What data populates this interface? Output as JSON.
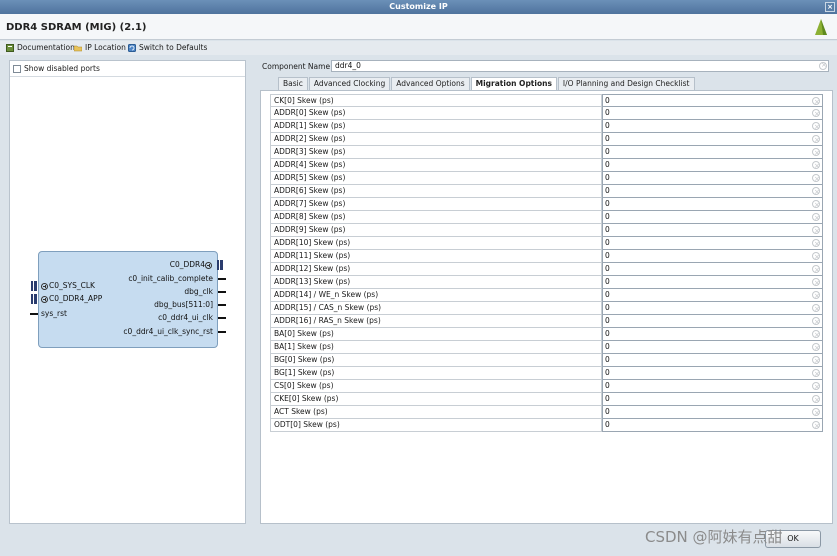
{
  "window": {
    "title": "Customize IP",
    "close_glyph": "×"
  },
  "header": {
    "app_title": "DDR4 SDRAM (MIG) (2.1)",
    "logo_icon": "vivado-logo-icon"
  },
  "toolbar": {
    "documentation": "Documentation",
    "ip_location": "IP Location",
    "switch_defaults": "Switch to Defaults"
  },
  "left_panel": {
    "show_disabled_ports": "Show disabled ports",
    "block": {
      "left_ports": [
        "C0_SYS_CLK",
        "C0_DDR4_APP",
        "sys_rst"
      ],
      "right_ports": [
        "C0_DDR4",
        "c0_init_calib_complete",
        "dbg_clk",
        "dbg_bus[511:0]",
        "c0_ddr4_ui_clk",
        "c0_ddr4_ui_clk_sync_rst"
      ]
    }
  },
  "component": {
    "label": "Component Name",
    "value": "ddr4_0"
  },
  "tabs": [
    {
      "label": "Basic"
    },
    {
      "label": "Advanced Clocking"
    },
    {
      "label": "Advanced Options"
    },
    {
      "label": "Migration Options"
    },
    {
      "label": "I/O Planning and Design Checklist"
    }
  ],
  "active_tab": "Migration Options",
  "skew_rows": [
    {
      "label": "CK[0] Skew (ps)",
      "value": "0"
    },
    {
      "label": "ADDR[0] Skew (ps)",
      "value": "0"
    },
    {
      "label": "ADDR[1] Skew (ps)",
      "value": "0"
    },
    {
      "label": "ADDR[2] Skew (ps)",
      "value": "0"
    },
    {
      "label": "ADDR[3] Skew (ps)",
      "value": "0"
    },
    {
      "label": "ADDR[4] Skew (ps)",
      "value": "0"
    },
    {
      "label": "ADDR[5] Skew (ps)",
      "value": "0"
    },
    {
      "label": "ADDR[6] Skew (ps)",
      "value": "0"
    },
    {
      "label": "ADDR[7] Skew (ps)",
      "value": "0"
    },
    {
      "label": "ADDR[8] Skew (ps)",
      "value": "0"
    },
    {
      "label": "ADDR[9] Skew (ps)",
      "value": "0"
    },
    {
      "label": "ADDR[10] Skew (ps)",
      "value": "0"
    },
    {
      "label": "ADDR[11] Skew (ps)",
      "value": "0"
    },
    {
      "label": "ADDR[12] Skew (ps)",
      "value": "0"
    },
    {
      "label": "ADDR[13] Skew (ps)",
      "value": "0"
    },
    {
      "label": "ADDR[14] / WE_n Skew (ps)",
      "value": "0"
    },
    {
      "label": "ADDR[15] / CAS_n Skew (ps)",
      "value": "0"
    },
    {
      "label": "ADDR[16] / RAS_n Skew (ps)",
      "value": "0"
    },
    {
      "label": "BA[0] Skew (ps)",
      "value": "0"
    },
    {
      "label": "BA[1] Skew (ps)",
      "value": "0"
    },
    {
      "label": "BG[0] Skew (ps)",
      "value": "0"
    },
    {
      "label": "BG[1] Skew (ps)",
      "value": "0"
    },
    {
      "label": "CS[0] Skew (ps)",
      "value": "0"
    },
    {
      "label": "CKE[0] Skew (ps)",
      "value": "0"
    },
    {
      "label": "ACT Skew (ps)",
      "value": "0"
    },
    {
      "label": "ODT[0] Skew (ps)",
      "value": "0"
    }
  ],
  "bottom": {
    "ok_label": "OK"
  },
  "watermark": "CSDN @阿妹有点甜",
  "colors": {
    "title_bar": "#4f739d",
    "block_fill": "#c6dcf0",
    "block_border": "#7f9fbd",
    "bus_color": "#2a3c6e"
  }
}
